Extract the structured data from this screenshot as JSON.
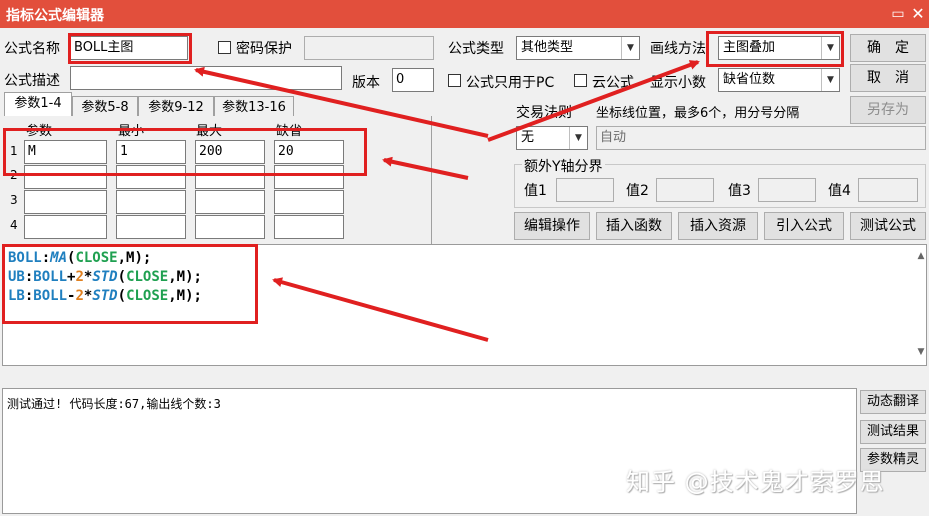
{
  "window": {
    "title": "指标公式编辑器",
    "minimize_icon": "▭",
    "close_icon": "✕"
  },
  "header": {
    "formula_name_label": "公式名称",
    "formula_name_value": "BOLL主图",
    "password_label": "密码保护",
    "password_checked": false,
    "password_value": "",
    "formula_type_label": "公式类型",
    "formula_type_value": "其他类型",
    "draw_method_label": "画线方法",
    "draw_method_value": "主图叠加",
    "ok_label": "确　定",
    "formula_desc_label": "公式描述",
    "formula_desc_value": "",
    "version_label": "版本",
    "version_value": "0",
    "pc_only_label": "公式只用于PC",
    "cloud_label": "云公式",
    "decimals_label": "显示小数",
    "decimals_value": "缺省位数",
    "cancel_label": "取　消",
    "save_as_label": "另存为"
  },
  "tabs": [
    "参数1-4",
    "参数5-8",
    "参数9-12",
    "参数13-16"
  ],
  "params": {
    "columns": [
      "参数",
      "最小",
      "最大",
      "缺省"
    ],
    "rows": [
      {
        "index": "1",
        "name": "M",
        "min": "1",
        "max": "200",
        "default": "20"
      },
      {
        "index": "2",
        "name": "",
        "min": "",
        "max": "",
        "default": ""
      },
      {
        "index": "3",
        "name": "",
        "min": "",
        "max": "",
        "default": ""
      },
      {
        "index": "4",
        "name": "",
        "min": "",
        "max": "",
        "default": ""
      }
    ]
  },
  "trade": {
    "rule_label": "交易法则",
    "rule_value": "无",
    "coord_label": "坐标线位置，最多6个，用分号分隔",
    "coord_value": "自动"
  },
  "yaxis": {
    "group_label": "额外Y轴分界",
    "value_labels": [
      "值1",
      "值2",
      "值3",
      "值4"
    ]
  },
  "actions": [
    "编辑操作",
    "插入函数",
    "插入资源",
    "引入公式",
    "测试公式"
  ],
  "code": {
    "lines": [
      [
        {
          "t": "BOLL",
          "c": "c-name"
        },
        {
          "t": ":",
          "c": "c-op"
        },
        {
          "t": "MA",
          "c": "c-fn"
        },
        {
          "t": "(",
          "c": "c-op"
        },
        {
          "t": "CLOSE",
          "c": "c-kw"
        },
        {
          "t": ",M);",
          "c": "c-op"
        }
      ],
      [
        {
          "t": "UB",
          "c": "c-name"
        },
        {
          "t": ":",
          "c": "c-op"
        },
        {
          "t": "BOLL",
          "c": "c-name"
        },
        {
          "t": "+",
          "c": "c-op"
        },
        {
          "t": "2",
          "c": "c-num"
        },
        {
          "t": "*",
          "c": "c-op"
        },
        {
          "t": "STD",
          "c": "c-fn"
        },
        {
          "t": "(",
          "c": "c-op"
        },
        {
          "t": "CLOSE",
          "c": "c-kw"
        },
        {
          "t": ",M);",
          "c": "c-op"
        }
      ],
      [
        {
          "t": "LB",
          "c": "c-name"
        },
        {
          "t": ":",
          "c": "c-op"
        },
        {
          "t": "BOLL",
          "c": "c-name"
        },
        {
          "t": "-",
          "c": "c-op"
        },
        {
          "t": "2",
          "c": "c-num"
        },
        {
          "t": "*",
          "c": "c-op"
        },
        {
          "t": "STD",
          "c": "c-fn"
        },
        {
          "t": "(",
          "c": "c-op"
        },
        {
          "t": "CLOSE",
          "c": "c-kw"
        },
        {
          "t": ",M);",
          "c": "c-op"
        }
      ]
    ]
  },
  "result": {
    "text": "测试通过! 代码长度:67,输出线个数:3"
  },
  "side_buttons": [
    "动态翻译",
    "测试结果",
    "参数精灵"
  ],
  "watermark": "知乎 @技术鬼才索罗思",
  "colors": {
    "titlebar": "#e24f3c",
    "highlight": "#e02020"
  }
}
